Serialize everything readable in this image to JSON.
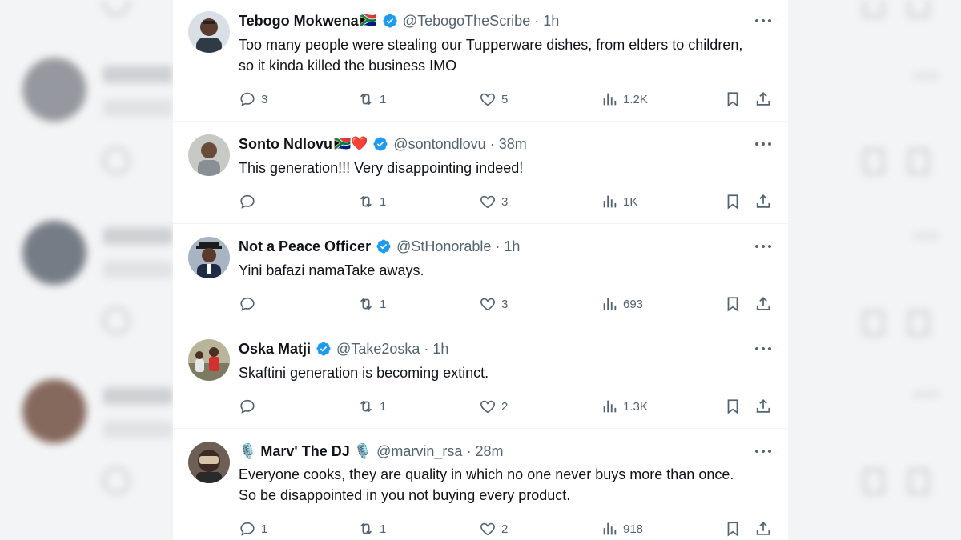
{
  "colors": {
    "verified": "#1d9bf0",
    "heart": "#e0245e",
    "secondary_text": "#536471",
    "primary_text": "#0f1419"
  },
  "tweets": [
    {
      "name": "Tebogo Mokwena",
      "name_emoji": "🇿🇦",
      "verified": true,
      "handle": "@TebogoTheScribe",
      "time": "1h",
      "text": "Too many people were stealing our Tupperware dishes, from elders to children, so it kinda killed the business IMO",
      "replies": "3",
      "retweets": "1",
      "likes": "5",
      "views": "1.2K"
    },
    {
      "name": "Sonto Ndlovu",
      "name_emoji": "🇿🇦❤️",
      "verified": true,
      "handle": "@sontondlovu",
      "time": "38m",
      "text": "This generation!!! Very disappointing indeed!",
      "replies": "",
      "retweets": "1",
      "likes": "3",
      "views": "1K"
    },
    {
      "name": "Not a Peace Officer",
      "name_emoji": "",
      "verified": true,
      "handle": "@StHonorable",
      "time": "1h",
      "text": "Yini bafazi namaTake aways.",
      "replies": "",
      "retweets": "1",
      "likes": "3",
      "views": "693"
    },
    {
      "name": "Oska Matji",
      "name_emoji": "",
      "verified": true,
      "handle": "@Take2oska",
      "time": "1h",
      "text": "Skaftini generation is becoming extinct.",
      "replies": "",
      "retweets": "1",
      "likes": "2",
      "views": "1.3K"
    },
    {
      "name": "🎙️ Marv' The DJ 🎙️",
      "name_emoji": "",
      "verified": false,
      "handle": "@marvin_rsa",
      "time": "28m",
      "text": "Everyone cooks, they are quality in which no one never buys more than once. So be disappointed in you not buying every product.",
      "replies": "1",
      "retweets": "1",
      "likes": "2",
      "views": "918"
    }
  ],
  "time_separator": "·"
}
